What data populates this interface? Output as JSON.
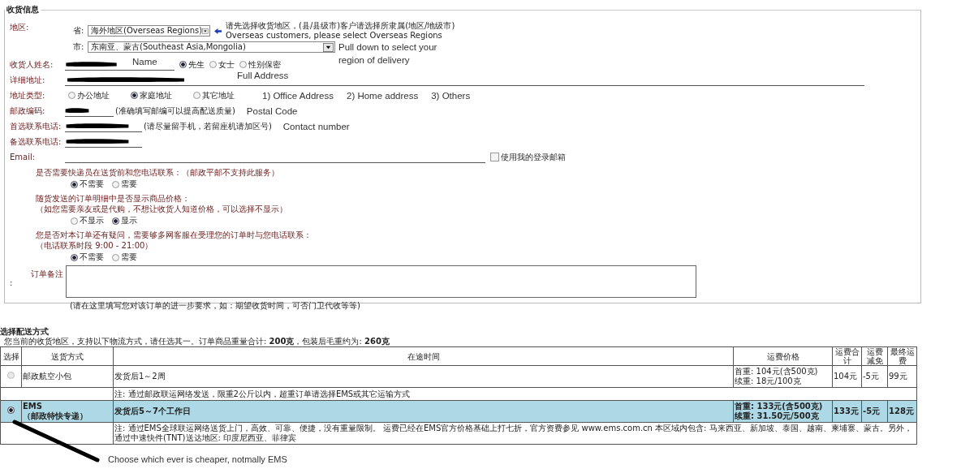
{
  "shipping_info": {
    "legend": "收货信息",
    "region": {
      "label": "地区:",
      "province": {
        "label": "省:",
        "value": "海外地区(Overseas Regions)"
      },
      "notice": [
        "请先选择收货地区，(县/县级市)客户请选择所隶属(地区/地级市)",
        "Overseas customers, please select Overseas Regions"
      ],
      "city": {
        "label": "市:",
        "value": "东南亚、蒙古(Southeast Asia,Mongolia)"
      },
      "annotation": [
        "Pull down to select your",
        "region of delivery"
      ]
    },
    "rows": [
      {
        "kind": "name",
        "label": "收货人姓名:",
        "redacted": true,
        "annotation": "Name",
        "options": [
          {
            "label": "先生",
            "selected": true
          },
          {
            "label": "女士",
            "selected": false
          },
          {
            "label": "性别保密",
            "selected": false
          }
        ]
      },
      {
        "kind": "address",
        "label": "详细地址:",
        "redacted": true,
        "annotation": "Full Address"
      },
      {
        "kind": "address_type",
        "label": "地址类型:",
        "options": [
          {
            "label": "办公地址",
            "selected": false
          },
          {
            "label": "家庭地址",
            "selected": true
          },
          {
            "label": "其它地址",
            "selected": false
          }
        ],
        "annotations": [
          "1) Office Address",
          "2) Home address",
          "3) Others"
        ]
      },
      {
        "kind": "postal",
        "label": "邮政编码:",
        "redacted": true,
        "hint": "(准确填写邮编可以提高配送质量)",
        "annotation": "Postal Code"
      },
      {
        "kind": "phone",
        "label": "首选联系电话:",
        "redacted": true,
        "hint": "(请尽量留手机，若留座机请加区号)",
        "annotation": "Contact number"
      },
      {
        "kind": "phone",
        "label": "备选联系电话:",
        "redacted": true
      },
      {
        "kind": "email",
        "label": "Email:",
        "redacted": false,
        "checkbox": {
          "label": "使用我的登录邮箱",
          "checked": false
        }
      }
    ],
    "questions": [
      {
        "lines": [
          "是否需要快递员在送货前和您电话联系：（邮政平邮不支持此服务）"
        ],
        "options": [
          {
            "label": "不需要",
            "selected": true
          },
          {
            "label": "需要",
            "selected": false
          }
        ]
      },
      {
        "lines": [
          "随货发送的订单明细中是否显示商品价格：",
          "（如您需要亲友或是代购，不想让收货人知道价格，可以选择不显示）"
        ],
        "options": [
          {
            "label": "不显示",
            "selected": false
          },
          {
            "label": "显示",
            "selected": true
          }
        ]
      },
      {
        "lines": [
          "您是否对本订单还有疑问，需要够多网客服在受理您的订单时与您电话联系：",
          "（电话联系时段 9:00 - 21:00）"
        ],
        "options": [
          {
            "label": "不需要",
            "selected": true
          },
          {
            "label": "需要",
            "selected": false
          }
        ]
      }
    ],
    "remarks": {
      "label": "订单备注",
      "colon": ":",
      "hint": "(请在这里填写您对该订单的进一步要求，如：期望收货时间，可否门卫代收等等)"
    }
  },
  "delivery": {
    "title": "选择配送方式",
    "summary": "您当前的收货地区，支持以下物流方式，请任选其一。订单商品重量合计: **200克**，包装后毛重约为: **260克**",
    "columns": [
      "选择",
      "送货方式",
      "在途时间",
      "运费价格",
      "运费合计",
      "运费减免",
      "最终运费"
    ],
    "methods": [
      {
        "selected": false,
        "name": [
          "邮政航空小包"
        ],
        "transit": "发货后1～2周",
        "price": [
          "首重: 104元(含500克)",
          "续重: 18元/100克"
        ],
        "total": "104元",
        "discount": "-5元",
        "final": "99元",
        "note": "注: 通过邮政联运网络发送，限重2公斤以内，超重订单请选择EMS或其它运输方式"
      },
      {
        "selected": true,
        "name": [
          "EMS",
          "（邮政特快专递）"
        ],
        "transit": "发货后5～7个工作日",
        "price": [
          "首重: 133元(含500克)",
          "续重: 31.50元/500克"
        ],
        "total": "133元",
        "discount": "-5元",
        "final": "128元",
        "note": "注: 通过EMS全球联运网络送货上门，高效、可靠、便捷，没有重量限制。 运费已经在EMS官方价格基础上打七折，官方资费参见 www.ems.com.cn 本区域内包含: 马来西亚、新加坡、泰国、越南、柬埔寨、蒙古。另外，通过中速快件(TNT)送达地区: 印度尼西亚、菲律宾"
      }
    ]
  },
  "bottom_annotation": "Choose which ever is cheaper, notmally EMS"
}
